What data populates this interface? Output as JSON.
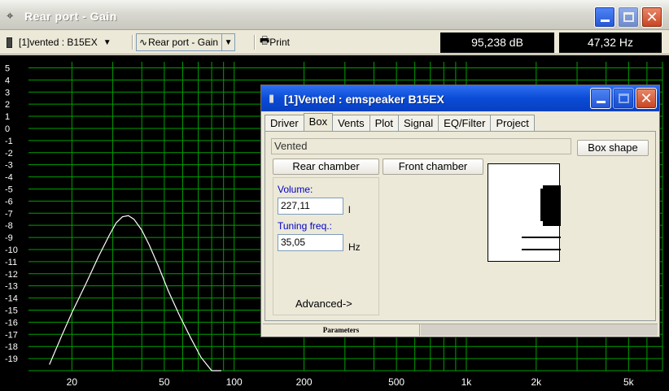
{
  "main_window": {
    "title": "Rear port - Gain"
  },
  "toolbar": {
    "driver_select": "[1]vented : B15EX",
    "graph_select": "Rear port - Gain",
    "print_label": "Print",
    "readout_db": "95,238 dB",
    "readout_hz": "47,32 Hz"
  },
  "plot": {
    "y_ticks": [
      "5",
      "4",
      "3",
      "2",
      "1",
      "0",
      "-1",
      "-2",
      "-3",
      "-4",
      "-5",
      "-6",
      "-7",
      "-8",
      "-9",
      "-10",
      "-11",
      "-12",
      "-13",
      "-14",
      "-15",
      "-16",
      "-17",
      "-18",
      "-19"
    ],
    "x_ticks": [
      "20",
      "50",
      "100",
      "200",
      "500",
      "1k",
      "2k",
      "5k"
    ],
    "grid_color": "#00a000",
    "curve_color": "#ffffff"
  },
  "dialog": {
    "title": "[1]Vented : emspeaker B15EX",
    "tabs": [
      "Driver",
      "Box",
      "Vents",
      "Plot",
      "Signal",
      "EQ/Filter",
      "Project"
    ],
    "active_tab": "Box",
    "box_type": "Vented",
    "box_shape_button": "Box shape",
    "rear_chamber_button": "Rear chamber",
    "front_chamber_button": "Front chamber",
    "volume_label": "Volume:",
    "volume_value": "227,11",
    "volume_unit": "l",
    "tuning_label": "Tuning freq.:",
    "tuning_value": "35,05",
    "tuning_unit": "Hz",
    "advanced_link": "Advanced->",
    "status_panel": "Parameters"
  },
  "chart_data": {
    "type": "line",
    "x_scale": "log",
    "xlim": [
      13,
      7000
    ],
    "ylim": [
      -20,
      5.5
    ],
    "x_tick_labels": [
      "20",
      "50",
      "100",
      "200",
      "500",
      "1k",
      "2k",
      "5k"
    ],
    "y_tick_labels": [
      "5",
      "4",
      "3",
      "2",
      "1",
      "0",
      "-1",
      "-2",
      "-3",
      "-4",
      "-5",
      "-6",
      "-7",
      "-8",
      "-9",
      "-10",
      "-11",
      "-12",
      "-13",
      "-14",
      "-15",
      "-16",
      "-17",
      "-18",
      "-19"
    ],
    "grid": true,
    "series": [
      {
        "x": [
          16,
          18,
          20,
          23,
          26,
          29,
          31,
          33,
          35,
          37,
          40,
          43,
          47,
          52,
          58,
          65,
          72,
          80,
          88
        ],
        "y": [
          -19.5,
          -17.2,
          -15.2,
          -12.8,
          -10.6,
          -8.8,
          -7.8,
          -7.3,
          -7.2,
          -7.5,
          -8.4,
          -9.6,
          -11.3,
          -13.4,
          -15.4,
          -17.3,
          -18.9,
          -20.0,
          -20.0
        ]
      }
    ]
  }
}
